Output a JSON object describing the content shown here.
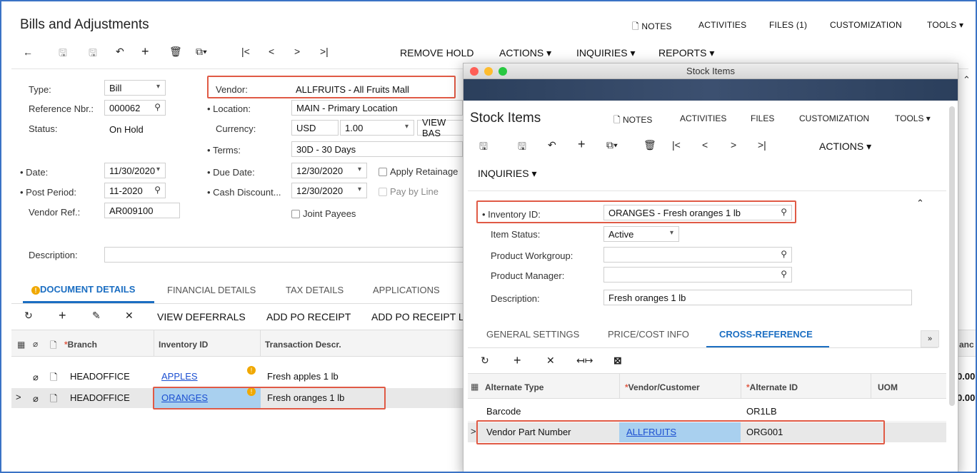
{
  "main": {
    "title": "Bills and Adjustments",
    "top_menu": [
      "NOTES",
      "ACTIVITIES",
      "FILES (1)",
      "CUSTOMIZATION",
      "TOOLS"
    ],
    "toolbar_text": [
      "REMOVE HOLD",
      "ACTIONS",
      "INQUIRIES",
      "REPORTS"
    ],
    "form": {
      "type_label": "Type:",
      "type_value": "Bill",
      "ref_label": "Reference Nbr.:",
      "ref_value": "000062",
      "status_label": "Status:",
      "status_value": "On Hold",
      "date_label": "Date:",
      "date_value": "11/30/2020",
      "period_label": "Post Period:",
      "period_value": "11-2020",
      "vendorref_label": "Vendor Ref.:",
      "vendorref_value": "AR009100",
      "desc_label": "Description:",
      "vendor_label": "Vendor:",
      "vendor_value": "ALLFRUITS - All Fruits Mall",
      "location_label": "Location:",
      "location_value": "MAIN - Primary Location",
      "currency_label": "Currency:",
      "currency_value": "USD",
      "currency_rate": "1.00",
      "view_base": "VIEW BAS",
      "terms_label": "Terms:",
      "terms_value": "30D - 30 Days",
      "duedate_label": "Due Date:",
      "duedate_value": "12/30/2020",
      "cashdisc_label": "Cash Discount...",
      "cashdisc_value": "12/30/2020",
      "apply_retainage": "Apply Retainage",
      "pay_by_line": "Pay by Line",
      "joint_payees": "Joint Payees"
    },
    "tabs": [
      "DOCUMENT DETAILS",
      "FINANCIAL DETAILS",
      "TAX DETAILS",
      "APPLICATIONS"
    ],
    "grid_toolbar": [
      "VIEW DEFERRALS",
      "ADD PO RECEIPT",
      "ADD PO RECEIPT L"
    ],
    "grid_headers": {
      "branch": "Branch",
      "inventory": "Inventory ID",
      "descr": "Transaction Descr."
    },
    "rows": [
      {
        "branch": "HEADOFFICE",
        "inventory": "APPLES",
        "descr": "Fresh apples 1 lb"
      },
      {
        "branch": "HEADOFFICE",
        "inventory": "ORANGES",
        "descr": "Fresh oranges 1 lb"
      }
    ],
    "right_col_header": "anc",
    "right_col_values": [
      "0.00",
      "0.00"
    ]
  },
  "popup": {
    "window_title": "Stock Items",
    "title": "Stock Items",
    "top_menu": [
      "NOTES",
      "ACTIVITIES",
      "FILES",
      "CUSTOMIZATION",
      "TOOLS"
    ],
    "actions": "ACTIONS",
    "inquiries": "INQUIRIES",
    "form": {
      "inv_label": "Inventory ID:",
      "inv_value": "ORANGES - Fresh oranges 1 lb",
      "status_label": "Item Status:",
      "status_value": "Active",
      "workgroup_label": "Product Workgroup:",
      "manager_label": "Product Manager:",
      "desc_label": "Description:",
      "desc_value": "Fresh oranges 1 lb"
    },
    "tabs": [
      "GENERAL SETTINGS",
      "PRICE/COST INFO",
      "CROSS-REFERENCE"
    ],
    "grid_headers": {
      "alt_type": "Alternate Type",
      "vendor": "Vendor/Customer",
      "alt_id": "Alternate ID",
      "uom": "UOM"
    },
    "rows": [
      {
        "alt_type": "Barcode",
        "vendor": "",
        "alt_id": "OR1LB"
      },
      {
        "alt_type": "Vendor Part Number",
        "vendor": "ALLFRUITS",
        "alt_id": "ORG001"
      }
    ]
  },
  "colors": {
    "accent": "#1b6ec2",
    "highlight": "#e05a45",
    "selected_row": "#e8e8e8",
    "link": "#1b4fd1"
  }
}
